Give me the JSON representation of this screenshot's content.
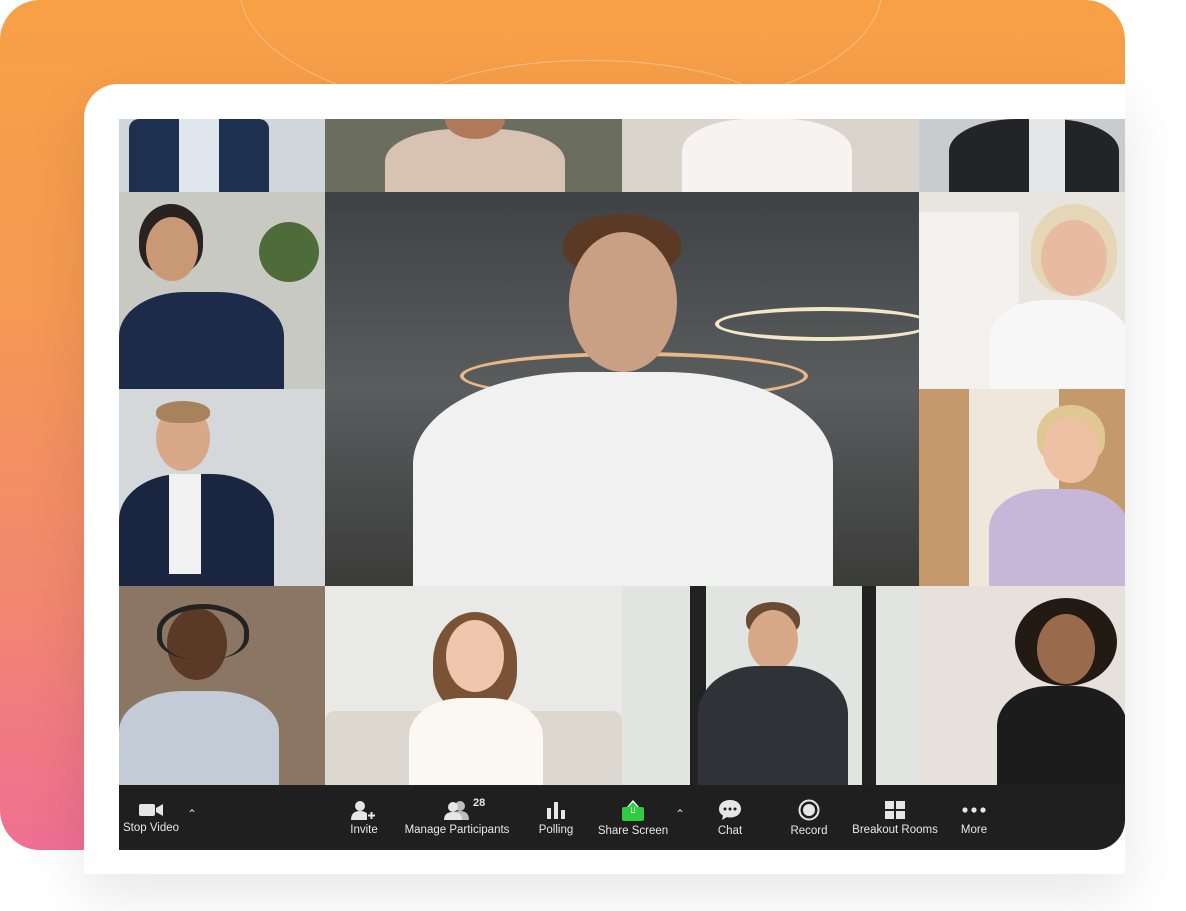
{
  "toolbar": {
    "stop_video": "Stop Video",
    "invite": "Invite",
    "manage_participants": "Manage Participants",
    "participants_count": "28",
    "polling": "Polling",
    "share_screen": "Share Screen",
    "chat": "Chat",
    "record": "Record",
    "breakout_rooms": "Breakout Rooms",
    "more": "More"
  },
  "colors": {
    "gradient_top": "#f7a046",
    "gradient_bottom": "#ef6f93",
    "toolbar_bg": "#1f1f1f",
    "share_screen_green": "#2ecc40"
  },
  "icons": [
    "video-camera-icon",
    "caret-up-icon",
    "add-person-icon",
    "participants-icon",
    "bar-chart-icon",
    "share-screen-arrow-icon",
    "chat-bubble-icon",
    "record-icon",
    "grid-icon",
    "more-dots-icon"
  ]
}
